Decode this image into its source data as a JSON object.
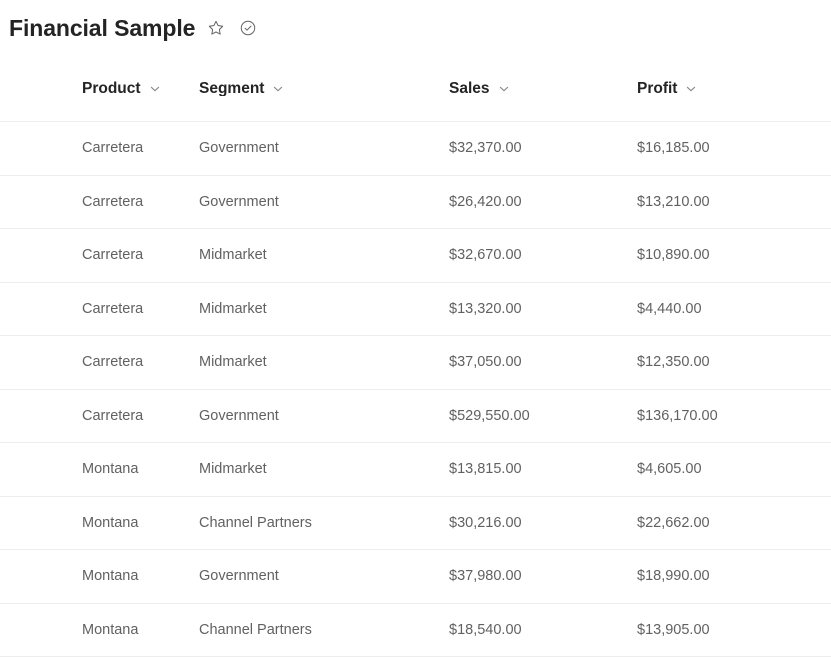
{
  "header": {
    "title": "Financial Sample",
    "favorite_icon": "star-outline-icon",
    "status_icon": "checkmark-circle-icon"
  },
  "table": {
    "columns": [
      {
        "label": "Product",
        "sort_icon": "chevron-down-icon"
      },
      {
        "label": "Segment",
        "sort_icon": "chevron-down-icon"
      },
      {
        "label": "Sales",
        "sort_icon": "chevron-down-icon"
      },
      {
        "label": "Profit",
        "sort_icon": "chevron-down-icon"
      }
    ],
    "rows": [
      {
        "product": "Carretera",
        "segment": "Government",
        "sales": "$32,370.00",
        "profit": "$16,185.00"
      },
      {
        "product": "Carretera",
        "segment": "Government",
        "sales": "$26,420.00",
        "profit": "$13,210.00"
      },
      {
        "product": "Carretera",
        "segment": "Midmarket",
        "sales": "$32,670.00",
        "profit": "$10,890.00"
      },
      {
        "product": "Carretera",
        "segment": "Midmarket",
        "sales": "$13,320.00",
        "profit": "$4,440.00"
      },
      {
        "product": "Carretera",
        "segment": "Midmarket",
        "sales": "$37,050.00",
        "profit": "$12,350.00"
      },
      {
        "product": "Carretera",
        "segment": "Government",
        "sales": "$529,550.00",
        "profit": "$136,170.00"
      },
      {
        "product": "Montana",
        "segment": "Midmarket",
        "sales": "$13,815.00",
        "profit": "$4,605.00"
      },
      {
        "product": "Montana",
        "segment": "Channel Partners",
        "sales": "$30,216.00",
        "profit": "$22,662.00"
      },
      {
        "product": "Montana",
        "segment": "Government",
        "sales": "$37,980.00",
        "profit": "$18,990.00"
      },
      {
        "product": "Montana",
        "segment": "Channel Partners",
        "sales": "$18,540.00",
        "profit": "$13,905.00"
      }
    ]
  },
  "colors": {
    "background": "#ffffff",
    "title_text": "#242424",
    "cell_text": "#616161",
    "separator": "#ededed",
    "icon_stroke": "#616161"
  }
}
